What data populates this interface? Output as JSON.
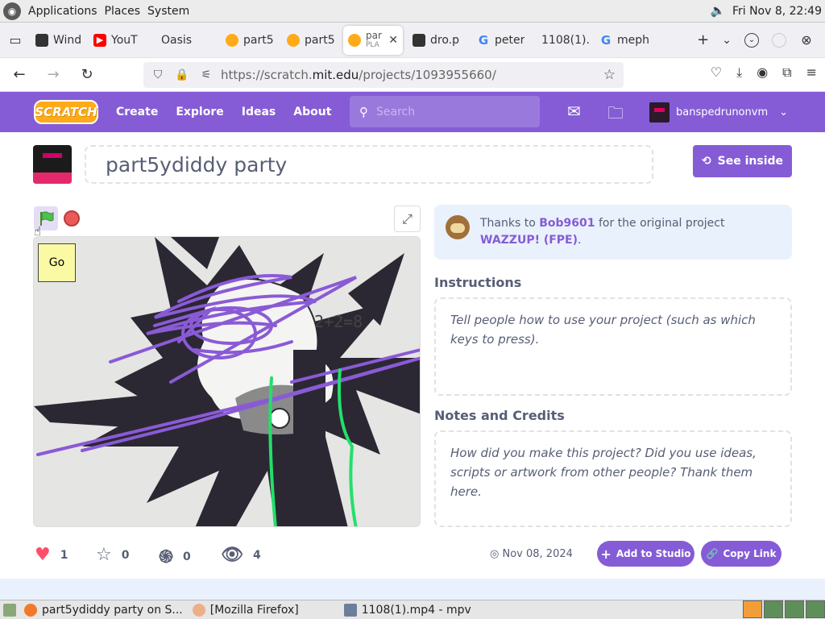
{
  "desktop_panel": {
    "menus": [
      "Applications",
      "Places",
      "System"
    ],
    "clock": "Fri Nov 8, 22:49"
  },
  "browser": {
    "tabs": [
      {
        "label": "Wind",
        "icon": "video-icon",
        "color": "#333333"
      },
      {
        "label": "YouT",
        "icon": "youtube-icon",
        "color": "#ff0000"
      },
      {
        "label": "Oasis",
        "icon": "globe-icon",
        "color": "#ffffff"
      },
      {
        "label": "part5",
        "icon": "scratch-icon",
        "color": "#ffab19"
      },
      {
        "label": "part5",
        "icon": "scratch-icon",
        "color": "#ffab19"
      },
      {
        "label": "part",
        "sub": "PLA",
        "icon": "scratch-icon",
        "color": "#ffab19",
        "active": true
      },
      {
        "label": "dro.p",
        "icon": "video-icon",
        "color": "#333333"
      },
      {
        "label": "peter",
        "icon": "google-icon",
        "color": "#4285f4"
      },
      {
        "label": "1108(1).",
        "icon": "none",
        "color": "#ffffff"
      },
      {
        "label": "meph",
        "icon": "google-icon",
        "color": "#4285f4"
      }
    ],
    "url_prefix": "https://scratch.",
    "url_host": "mit.edu",
    "url_path": "/projects/1093955660/"
  },
  "scratch_nav": {
    "logo": "SCRATCH",
    "items": [
      "Create",
      "Explore",
      "Ideas",
      "About"
    ],
    "search_placeholder": "Search",
    "username": "banspedrunonvm"
  },
  "project": {
    "title": "part5ydiddy party",
    "see_inside": "See inside",
    "go_label": "Go",
    "remix_prefix": "Thanks to ",
    "remix_user": "Bob9601",
    "remix_middle": " for the original project ",
    "remix_project": "WAZZUP! (FPE)",
    "remix_suffix": ".",
    "instructions_heading": "Instructions",
    "instructions_placeholder": "Tell people how to use your project (such as which keys to press).",
    "notes_heading": "Notes and Credits",
    "notes_placeholder": "How did you make this project? Did you use ideas, scripts or artwork from other people? Thank them here.",
    "stats": {
      "loves": "1",
      "favorites": "0",
      "remixes": "0",
      "views": "4"
    },
    "date": "Nov 08, 2024",
    "add_to_studio": "Add to Studio",
    "copy_link": "Copy Link",
    "stage_math_text": "2+2=8"
  },
  "taskbar": {
    "tasks": [
      "part5ydiddy party on S...",
      "[Mozilla Firefox]",
      "1108(1).mp4 - mpv"
    ]
  },
  "colors": {
    "scratch_purple": "#855cd6",
    "scratch_orange": "#ffab19",
    "scribble_purple": "#8a5ad6",
    "scribble_green": "#22e06a"
  }
}
